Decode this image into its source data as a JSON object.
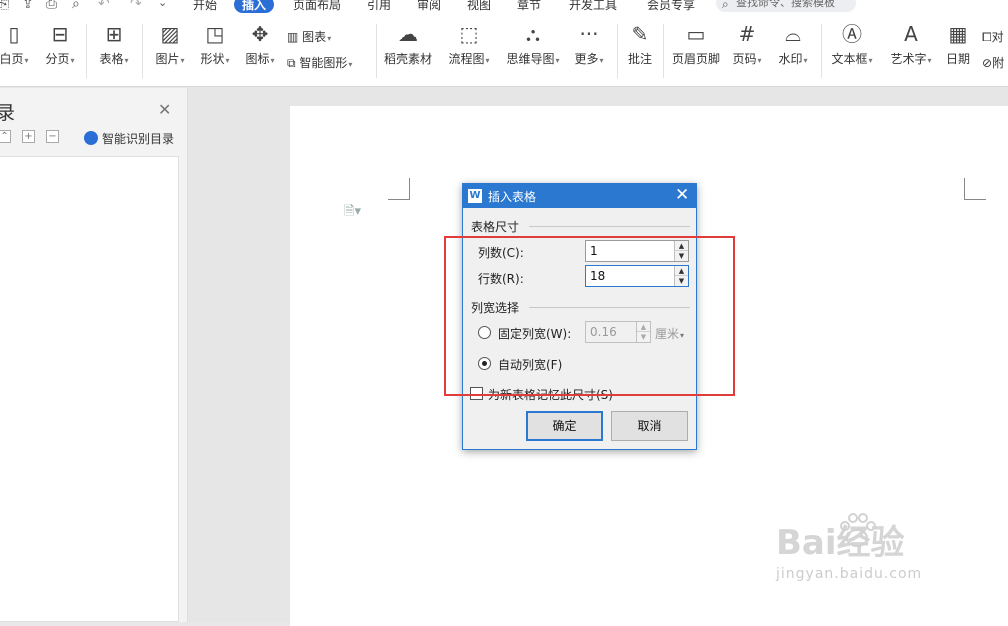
{
  "quickaccess": {
    "icons": [
      "open-icon",
      "share-icon",
      "print-icon",
      "print-preview-icon",
      "undo-icon",
      "redo-icon",
      "customize-icon"
    ]
  },
  "menu": {
    "tabs": [
      {
        "label": "开始"
      },
      {
        "label": "插入",
        "active": true
      },
      {
        "label": "页面布局"
      },
      {
        "label": "引用"
      },
      {
        "label": "审阅"
      },
      {
        "label": "视图"
      },
      {
        "label": "章节"
      },
      {
        "label": "开发工具"
      },
      {
        "label": "会员专享"
      }
    ],
    "search_placeholder": "查找命令、搜索模板"
  },
  "ribbon": {
    "blank_page": "白页",
    "page_break": "分页",
    "table": "表格",
    "picture": "图片",
    "shape": "形状",
    "icon": "图标",
    "chart": "图表",
    "smartart": "智能图形",
    "materials": "稻壳素材",
    "flowchart": "流程图",
    "mindmap": "思维导图",
    "more": "更多",
    "comment": "批注",
    "header_footer": "页眉页脚",
    "page_number": "页码",
    "watermark": "水印",
    "textbox": "文本框",
    "wordart": "艺术字",
    "date": "日期",
    "object": "对",
    "attachment": "附"
  },
  "navpane": {
    "title": "录",
    "smart_toc": "智能识别目录"
  },
  "dialog": {
    "title": "插入表格",
    "size_group": "表格尺寸",
    "columns_label": "列数(C):",
    "columns_value": "1",
    "rows_label": "行数(R):",
    "rows_value": "18",
    "width_group": "列宽选择",
    "fixed_label": "固定列宽(W):",
    "fixed_value": "0.16",
    "unit": "厘米",
    "auto_label": "自动列宽(F)",
    "remember_label": "为新表格记忆此尺寸(S)",
    "ok": "确定",
    "cancel": "取消",
    "auto_selected": true,
    "remember_checked": false
  },
  "watermark_text": {
    "brand": "Bai经验",
    "url": "jingyan.baidu.com"
  },
  "colors": {
    "accent": "#2b78d0",
    "highlight": "#e03c3c",
    "active_tab": "#2b6fd6"
  }
}
